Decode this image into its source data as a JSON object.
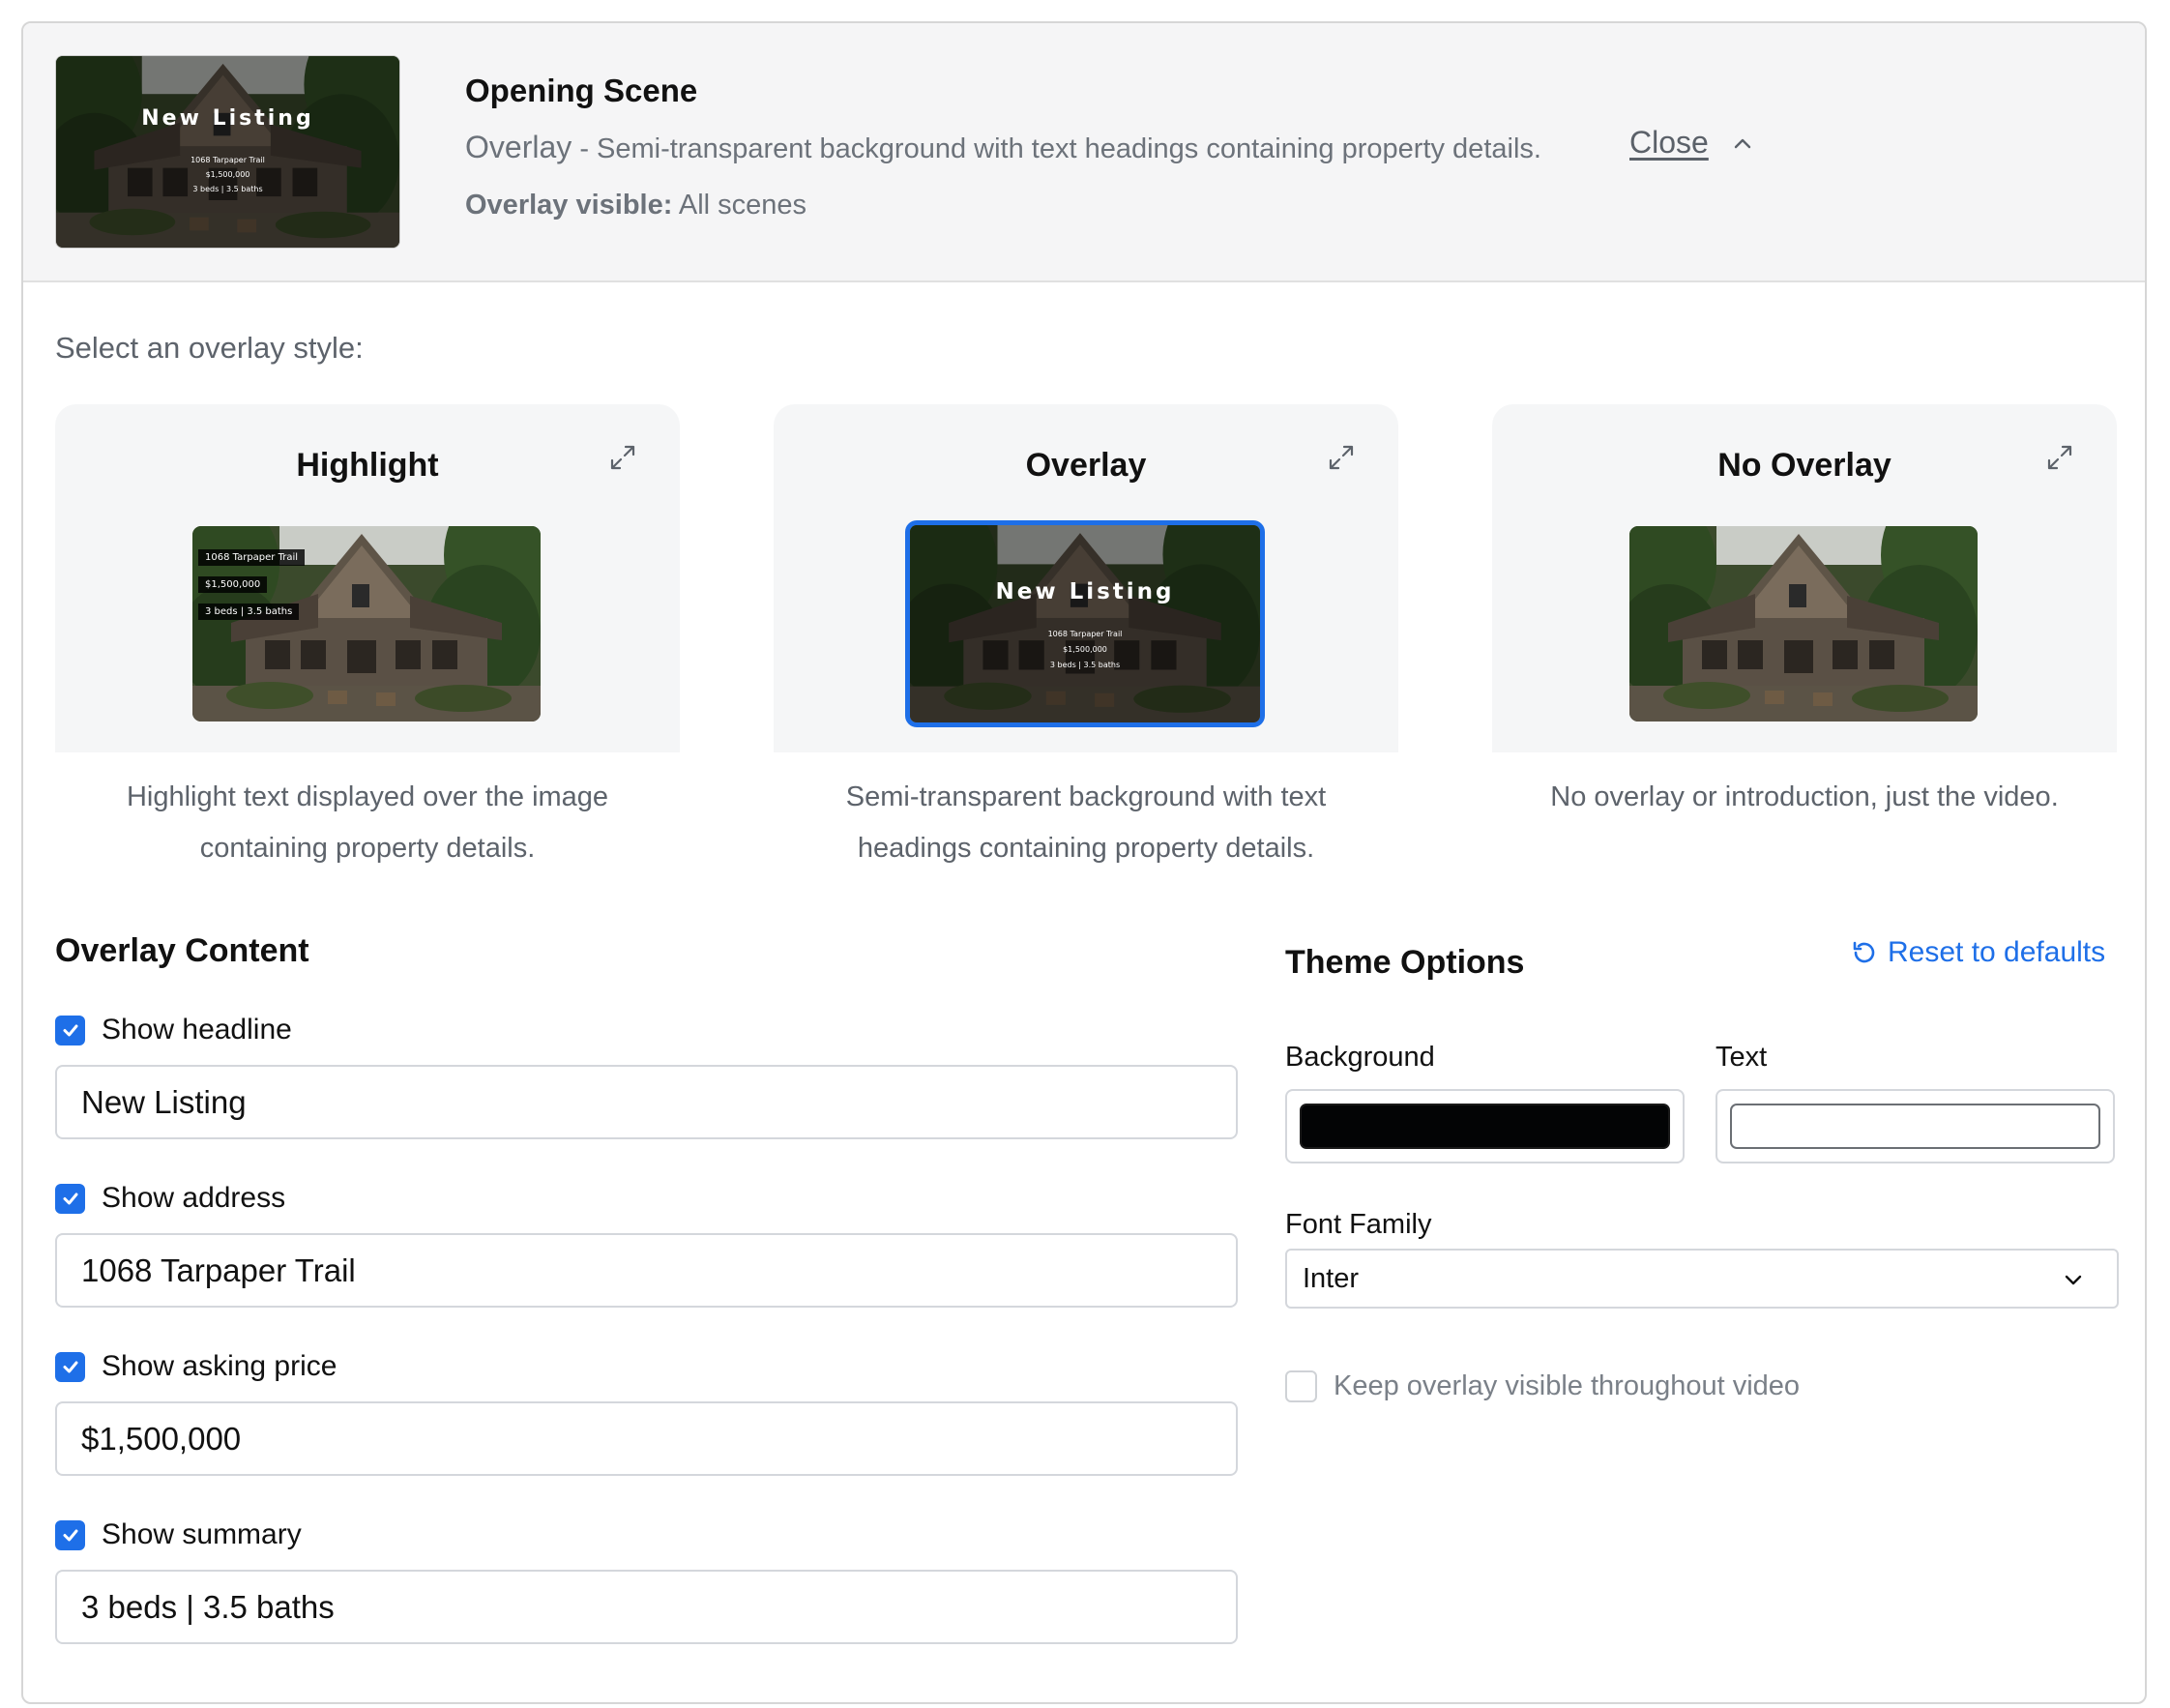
{
  "header": {
    "title": "Opening Scene",
    "style_name": "Overlay",
    "separator": "-",
    "description": "Semi-transparent background with text headings containing property details.",
    "visible_label": "Overlay visible:",
    "visible_value": "All scenes",
    "close_label": "Close"
  },
  "select_label": "Select an overlay style:",
  "preview_text": {
    "headline": "New Listing",
    "address": "1068 Tarpaper Trail",
    "price": "$1,500,000",
    "summary": "3 beds | 3.5 baths"
  },
  "styles": [
    {
      "title": "Highlight",
      "desc_line1": "Highlight text displayed over the image",
      "desc_line2": "containing property details.",
      "selected": false
    },
    {
      "title": "Overlay",
      "desc_line1": "Semi-transparent background with text",
      "desc_line2": "headings containing property details.",
      "selected": true
    },
    {
      "title": "No Overlay",
      "desc_line1": "No overlay or introduction, just the video.",
      "desc_line2": "",
      "selected": false
    }
  ],
  "overlay_content": {
    "title": "Overlay Content",
    "fields": [
      {
        "label": "Show headline",
        "checked": true,
        "value": "New Listing"
      },
      {
        "label": "Show address",
        "checked": true,
        "value": "1068 Tarpaper Trail"
      },
      {
        "label": "Show asking price",
        "checked": true,
        "value": "$1,500,000"
      },
      {
        "label": "Show summary",
        "checked": true,
        "value": "3 beds | 3.5 baths"
      }
    ]
  },
  "theme": {
    "title": "Theme Options",
    "reset_label": "Reset to defaults",
    "background_label": "Background",
    "background_color": "#030405",
    "text_label": "Text",
    "text_color": "#ffffff",
    "font_label": "Font Family",
    "font_value": "Inter",
    "keep_visible_label": "Keep overlay visible throughout video",
    "keep_visible_checked": false
  },
  "colors": {
    "accent": "#1e6fe8",
    "muted_text": "#5d636b",
    "card_bg": "#f5f6f7"
  }
}
